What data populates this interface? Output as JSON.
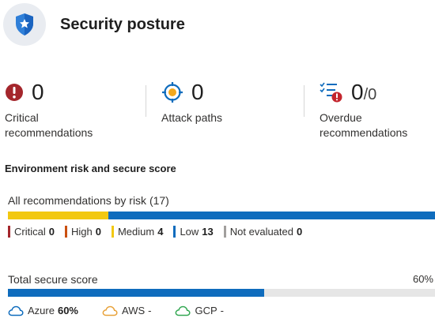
{
  "header": {
    "title": "Security posture",
    "icon": "shield-icon"
  },
  "kpis": [
    {
      "value": "0",
      "label_line1": "Critical",
      "label_line2": "recommendations",
      "icon": "critical-alert-icon",
      "color": "#a4262c"
    },
    {
      "value": "0",
      "label_line1": "Attack paths",
      "label_line2": "",
      "icon": "attack-path-target-icon",
      "color": "#0f6cbd"
    },
    {
      "value": "0",
      "denominator": "/0",
      "label_line1": "Overdue",
      "label_line2": "recommendations",
      "icon": "overdue-list-icon",
      "color": "#0f6cbd"
    }
  ],
  "section_title": "Environment risk and secure score",
  "risk": {
    "label": "All recommendations by risk (17)",
    "legend": [
      {
        "name": "Critical",
        "count": "0",
        "color": "#a4262c",
        "fraction": 0
      },
      {
        "name": "High",
        "count": "0",
        "color": "#ca5010",
        "fraction": 0
      },
      {
        "name": "Medium",
        "count": "4",
        "color": "#f2c811",
        "fraction": 0.235
      },
      {
        "name": "Low",
        "count": "13",
        "color": "#0f6cbd",
        "fraction": 0.765
      },
      {
        "name": "Not evaluated",
        "count": "0",
        "color": "#a19f9d",
        "fraction": 0
      }
    ]
  },
  "secure_score": {
    "label": "Total secure score",
    "percent_text": "60%",
    "fraction": 0.6,
    "color": "#0f6cbd"
  },
  "clouds": [
    {
      "name": "Azure",
      "value": "60%",
      "bold": true,
      "icon": "azure-cloud-icon",
      "color": "#0f6cbd"
    },
    {
      "name": "AWS",
      "value": "-",
      "bold": false,
      "icon": "aws-cloud-icon",
      "color": "#e8a23a"
    },
    {
      "name": "GCP",
      "value": "-",
      "bold": false,
      "icon": "gcp-cloud-icon",
      "color": "#34a853"
    }
  ]
}
